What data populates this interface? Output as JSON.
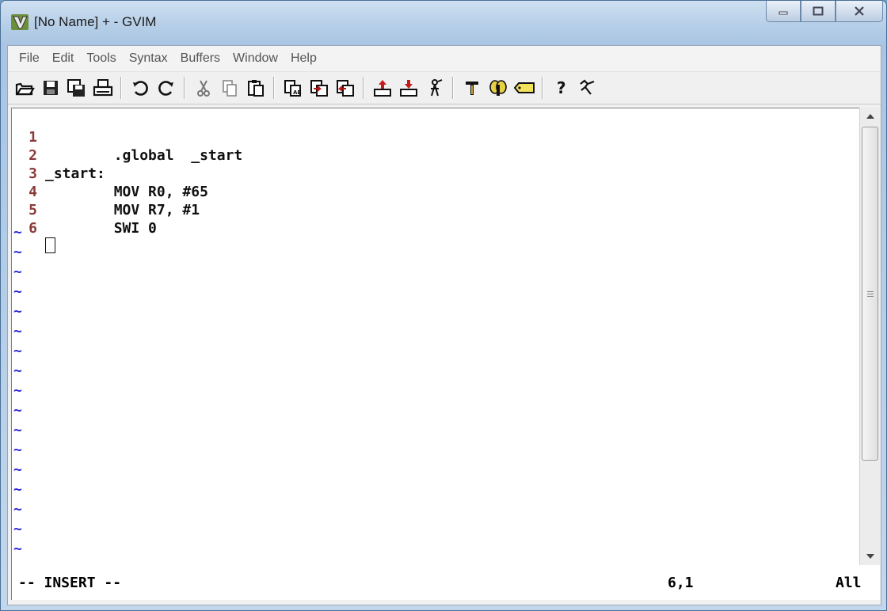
{
  "window": {
    "title": "[No Name] + - GVIM",
    "icon": "gvim-icon",
    "controls": [
      "minimize",
      "maximize",
      "close"
    ]
  },
  "menu": {
    "items": [
      "File",
      "Edit",
      "Tools",
      "Syntax",
      "Buffers",
      "Window",
      "Help"
    ]
  },
  "toolbar": {
    "buttons": [
      {
        "name": "open-icon"
      },
      {
        "name": "save-icon"
      },
      {
        "name": "save-all-icon"
      },
      {
        "name": "print-icon"
      },
      {
        "name": "undo-icon"
      },
      {
        "name": "redo-icon"
      },
      {
        "name": "cut-icon"
      },
      {
        "name": "copy-icon"
      },
      {
        "name": "paste-icon"
      },
      {
        "name": "load-session-icon"
      },
      {
        "name": "save-session-icon"
      },
      {
        "name": "run-script-icon"
      },
      {
        "name": "make-icon"
      },
      {
        "name": "shell-icon"
      },
      {
        "name": "run-ctags-icon"
      },
      {
        "name": "hammer-icon"
      },
      {
        "name": "tags-jump-icon"
      },
      {
        "name": "tag-icon"
      },
      {
        "name": "help-icon"
      },
      {
        "name": "find-help-icon"
      }
    ]
  },
  "editor": {
    "lines": [
      {
        "num": "1",
        "text": "        .global  _start"
      },
      {
        "num": "2",
        "text": "_start:"
      },
      {
        "num": "3",
        "text": "        MOV R0, #65"
      },
      {
        "num": "4",
        "text": "        MOV R7, #1"
      },
      {
        "num": "5",
        "text": "        SWI 0"
      },
      {
        "num": "6",
        "text": ""
      }
    ],
    "empty_marker": "~",
    "empty_line_count": 17
  },
  "status": {
    "mode": "-- INSERT --",
    "position": "6,1",
    "scroll": "All"
  },
  "colors": {
    "line_number": "#8b3a3a",
    "tilde": "#2a2ad8",
    "text": "#111111"
  }
}
